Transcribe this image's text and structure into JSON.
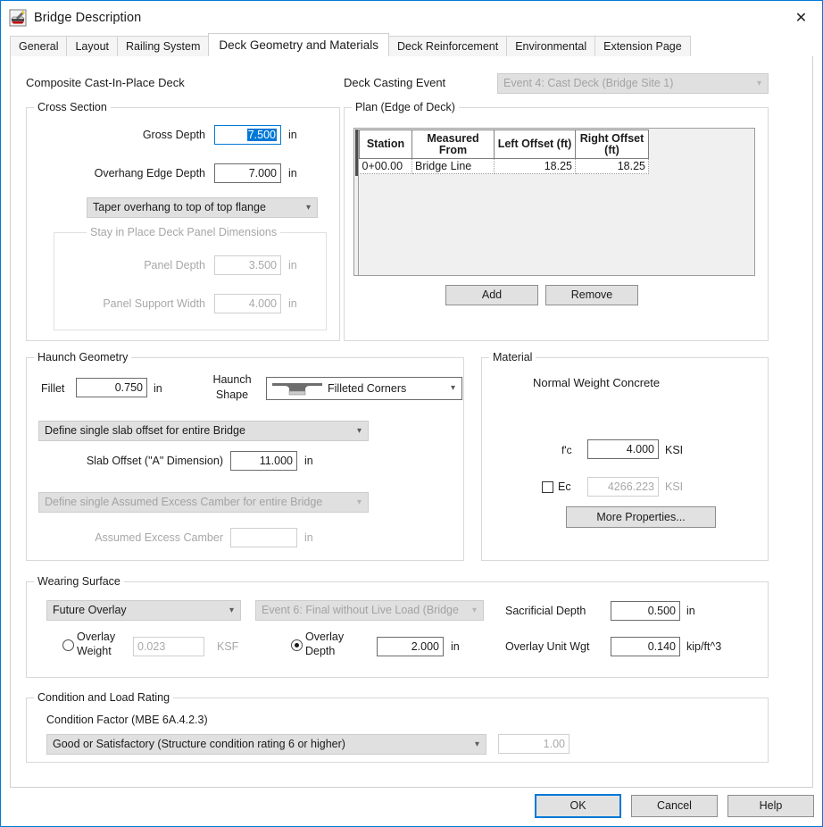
{
  "window": {
    "title": "Bridge Description",
    "app_icon": "bridge-description-icon",
    "close_label": "✕"
  },
  "tabs": [
    {
      "label": "General",
      "active": false
    },
    {
      "label": "Layout",
      "active": false
    },
    {
      "label": "Railing System",
      "active": false
    },
    {
      "label": "Deck Geometry and Materials",
      "active": true
    },
    {
      "label": "Deck Reinforcement",
      "active": false
    },
    {
      "label": "Environmental",
      "active": false
    },
    {
      "label": "Extension Page",
      "active": false
    }
  ],
  "deck": {
    "heading": "Composite Cast-In-Place Deck",
    "casting_event_label": "Deck Casting Event",
    "casting_event_value": "Event 4: Cast Deck (Bridge Site 1)"
  },
  "cross_section": {
    "legend": "Cross Section",
    "gross_depth_label": "Gross Depth",
    "gross_depth_value": "7.500",
    "gross_depth_unit": "in",
    "overhang_edge_depth_label": "Overhang Edge Depth",
    "overhang_edge_depth_value": "7.000",
    "overhang_edge_depth_unit": "in",
    "taper_option": "Taper overhang to top of top flange",
    "sip_legend": "Stay in Place Deck Panel Dimensions",
    "panel_depth_label": "Panel Depth",
    "panel_depth_value": "3.500",
    "panel_depth_unit": "in",
    "panel_support_width_label": "Panel Support Width",
    "panel_support_width_value": "4.000",
    "panel_support_width_unit": "in"
  },
  "plan": {
    "legend": "Plan (Edge of Deck)",
    "columns": [
      "Station",
      "Measured From",
      "Left Offset (ft)",
      "Right Offset (ft)"
    ],
    "rows": [
      {
        "station": "0+00.00",
        "measured_from": "Bridge Line",
        "left_offset": "18.25",
        "right_offset": "18.25"
      }
    ],
    "add_label": "Add",
    "remove_label": "Remove"
  },
  "haunch": {
    "legend": "Haunch Geometry",
    "fillet_label": "Fillet",
    "fillet_value": "0.750",
    "fillet_unit": "in",
    "haunch_shape_label_line1": "Haunch",
    "haunch_shape_label_line2": "Shape",
    "haunch_shape_value": "Filleted Corners",
    "haunch_shape_icon": "filleted-corners-icon",
    "slab_offset_mode": "Define single slab offset for entire Bridge",
    "slab_offset_label": "Slab Offset (\"A\" Dimension)",
    "slab_offset_value": "11.000",
    "slab_offset_unit": "in",
    "camber_mode": "Define single Assumed Excess Camber for entire Bridge",
    "camber_label": "Assumed Excess Camber",
    "camber_value": "",
    "camber_unit": "in"
  },
  "material": {
    "legend": "Material",
    "concrete_name": "Normal Weight Concrete",
    "fc_label": "f'c",
    "fc_value": "4.000",
    "fc_unit": "KSI",
    "ec_label": "Ec",
    "ec_value": "4266.223",
    "ec_unit": "KSI",
    "ec_checked": false,
    "more_properties_label": "More Properties..."
  },
  "wearing_surface": {
    "legend": "Wearing Surface",
    "type_value": "Future Overlay",
    "event_value": "Event 6: Final without Live Load (Bridge",
    "overlay_weight_label_line1": "Overlay",
    "overlay_weight_label_line2": "Weight",
    "overlay_weight_value": "0.023",
    "overlay_weight_unit": "KSF",
    "overlay_weight_selected": false,
    "overlay_depth_label_line1": "Overlay",
    "overlay_depth_label_line2": "Depth",
    "overlay_depth_value": "2.000",
    "overlay_depth_unit": "in",
    "overlay_depth_selected": true,
    "sacrificial_depth_label": "Sacrificial Depth",
    "sacrificial_depth_value": "0.500",
    "sacrificial_depth_unit": "in",
    "overlay_unit_wgt_label": "Overlay Unit Wgt",
    "overlay_unit_wgt_value": "0.140",
    "overlay_unit_wgt_unit": "kip/ft^3"
  },
  "condition": {
    "legend": "Condition and Load Rating",
    "factor_label": "Condition Factor (MBE 6A.4.2.3)",
    "factor_value": "Good or Satisfactory (Structure condition rating 6 or higher)",
    "factor_number": "1.00"
  },
  "footer": {
    "ok_label": "OK",
    "cancel_label": "Cancel",
    "help_label": "Help"
  },
  "colors": {
    "accent": "#0078d7",
    "combo_bg": "#e0e0e0",
    "disabled_text": "#a8a8a8"
  }
}
